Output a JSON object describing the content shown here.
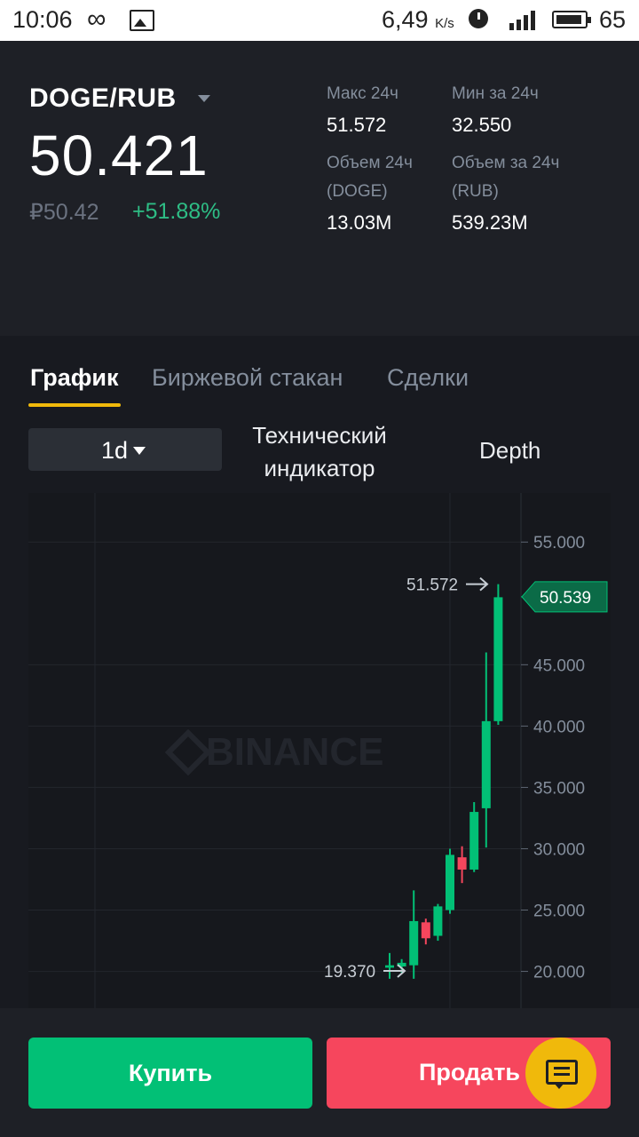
{
  "status_bar": {
    "time": "10:06",
    "infinity_glyph": "∞",
    "net_speed": "6,49",
    "net_unit": "K/s",
    "battery": "65"
  },
  "ticker": {
    "pair": "DOGE/RUB",
    "last_price": "50.421",
    "fiat_price": "₽50.42",
    "change": "+51.88%",
    "stats": {
      "high_label": "Макс 24ч",
      "high_value": "51.572",
      "low_label": "Мин за 24ч",
      "low_value": "32.550",
      "vol_base_label": "Объем 24ч",
      "vol_base_unit": "(DOGE)",
      "vol_base_value": "13.03M",
      "vol_quote_label": "Объем за 24ч",
      "vol_quote_unit": "(RUB)",
      "vol_quote_value": "539.23M"
    }
  },
  "tabs": [
    {
      "label": "График",
      "active": true
    },
    {
      "label": "Биржевой стакан",
      "active": false
    },
    {
      "label": "Сделки",
      "active": false
    }
  ],
  "toolbar": {
    "interval": "1d",
    "indicator_label_line1": "Технический",
    "indicator_label_line2": "индикатор",
    "depth_label": "Depth"
  },
  "chart_data": {
    "type": "candlestick",
    "watermark": "BINANCE",
    "y_ticks": [
      "55.000",
      "45.000",
      "40.000",
      "35.000",
      "30.000",
      "25.000",
      "20.000"
    ],
    "ylim": [
      17.0,
      59.0
    ],
    "high_marker": "51.572",
    "low_marker": "19.370",
    "last_price_tag": "50.539",
    "candles": [
      {
        "open": 20.3,
        "close": 20.5,
        "high": 21.5,
        "low": 19.4
      },
      {
        "open": 20.4,
        "close": 20.7,
        "high": 21.0,
        "low": 19.9
      },
      {
        "open": 20.5,
        "close": 24.1,
        "high": 26.6,
        "low": 19.4
      },
      {
        "open": 24.0,
        "close": 22.7,
        "high": 24.3,
        "low": 22.2
      },
      {
        "open": 22.9,
        "close": 25.3,
        "high": 25.5,
        "low": 22.5
      },
      {
        "open": 25.0,
        "close": 29.5,
        "high": 30.0,
        "low": 24.7
      },
      {
        "open": 29.3,
        "close": 28.3,
        "high": 30.2,
        "low": 27.2
      },
      {
        "open": 28.3,
        "close": 33.0,
        "high": 33.8,
        "low": 28.1
      },
      {
        "open": 33.3,
        "close": 40.4,
        "high": 46.0,
        "low": 30.1
      },
      {
        "open": 40.4,
        "close": 50.5,
        "high": 51.572,
        "low": 40.1
      }
    ],
    "colors": {
      "up": "#02c076",
      "down": "#f6465d"
    }
  },
  "actions": {
    "buy_label": "Купить",
    "sell_label": "Продать"
  }
}
